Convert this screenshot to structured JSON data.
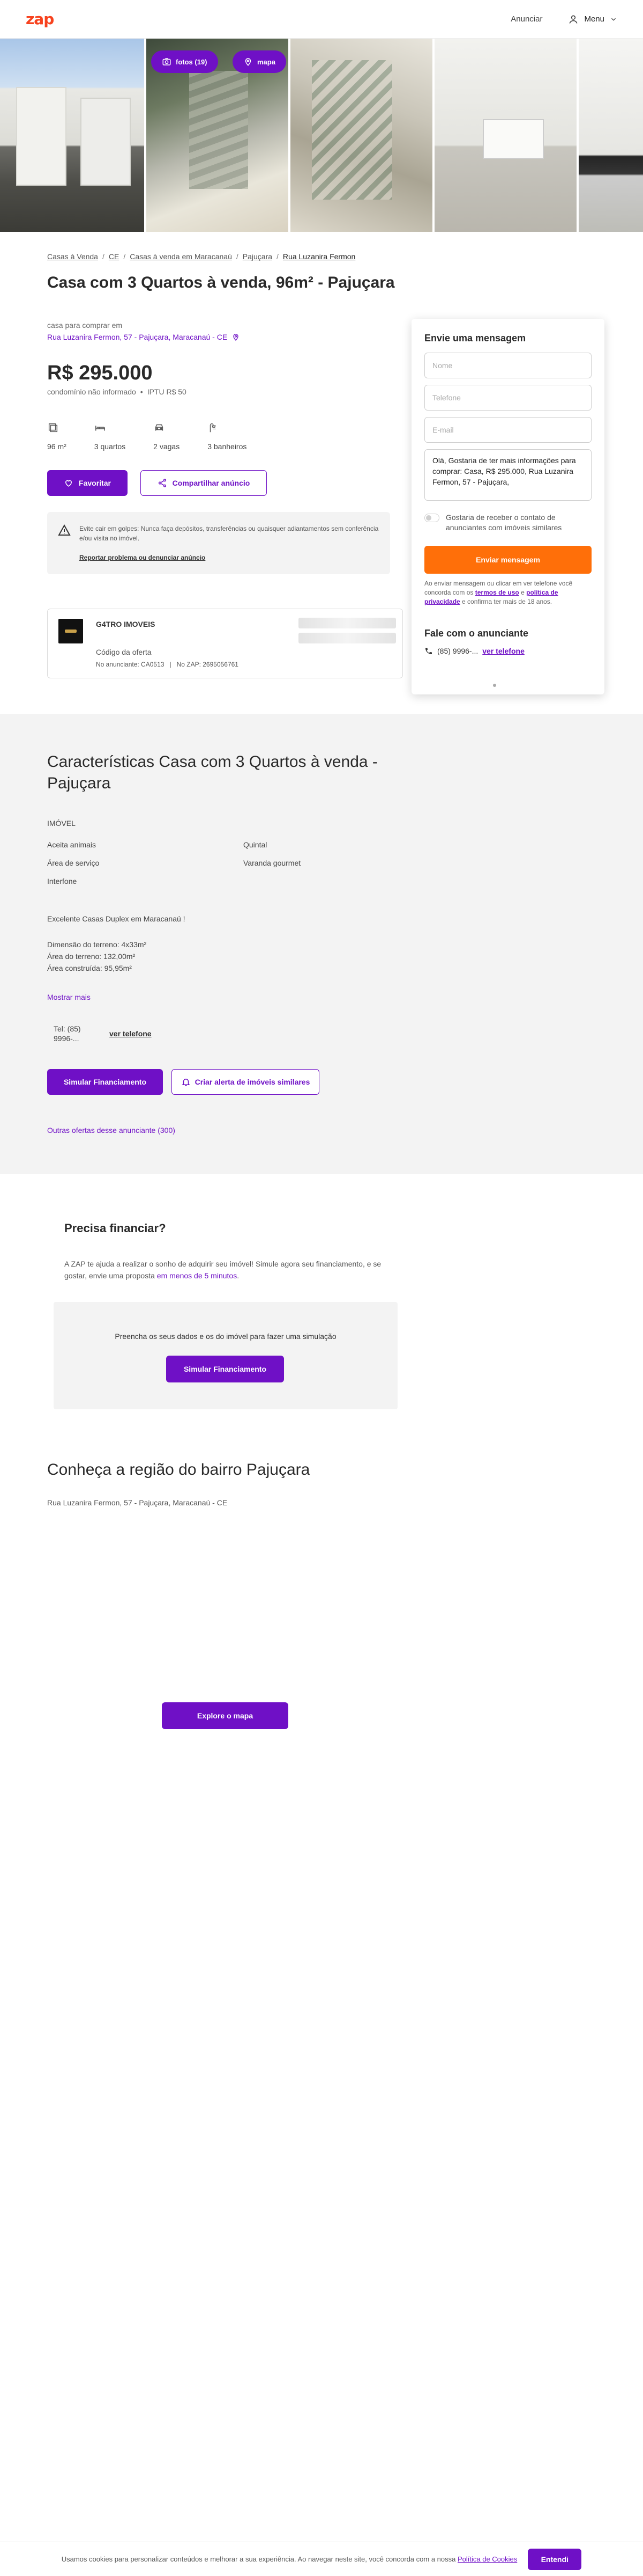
{
  "header": {
    "logo": "zap",
    "announce_label": "Anunciar",
    "menu_label": "Menu"
  },
  "gallery": {
    "photos_button": "fotos (19)",
    "map_button": "mapa"
  },
  "breadcrumb": [
    "Casas à Venda",
    "CE",
    "Casas à venda em Maracanaú",
    "Pajuçara",
    "Rua Luzanira Fermon"
  ],
  "listing": {
    "title": "Casa com 3 Quartos à venda, 96m² - Pajuçara",
    "subtitle": "casa para comprar em",
    "address": "Rua Luzanira Fermon, 57 - Pajuçara, Maracanaú - CE",
    "price": "R$ 295.000",
    "condo": "condomínio não informado",
    "bullet": "•",
    "iptu": "IPTU R$ 50",
    "amenities": [
      {
        "icon": "area-icon",
        "label": "96 m²"
      },
      {
        "icon": "bed-icon",
        "label": "3 quartos"
      },
      {
        "icon": "car-icon",
        "label": "2 vagas"
      },
      {
        "icon": "shower-icon",
        "label": "3 banheiros"
      }
    ],
    "favorite_label": "Favoritar",
    "share_label": "Compartilhar anúncio",
    "warning_text": "Evite cair em golpes: Nunca faça depósitos, transferências ou quaisquer adiantamentos sem conferência e/ou visita no imóvel.",
    "report_label": "Reportar problema ou denunciar anúncio"
  },
  "advertiser": {
    "name": "G4TRO IMOVEIS",
    "code_label": "Código da oferta",
    "advertiser_code": "No anunciante: CA0513",
    "separator": "|",
    "zap_code": "No ZAP: 2695056761"
  },
  "contact": {
    "title": "Envie uma mensagem",
    "name_placeholder": "Nome",
    "phone_placeholder": "Telefone",
    "email_placeholder": "E-mail",
    "message": "Olá, Gostaria de ter mais informações para comprar: Casa, R$ 295.000, Rua Luzanira Fermon, 57 - Pajuçara,",
    "consent": "Gostaria de receber o contato de anunciantes com imóveis similares",
    "send_label": "Enviar mensagem",
    "legal_1": "Ao enviar mensagem ou clicar em ver telefone você concorda com os",
    "terms_label": "termos de uso",
    "legal_2": "e",
    "privacy_label": "política de privacidade",
    "legal_3": "e confirma ter mais de 18 anos.",
    "advertiser_title": "Fale com o anunciante",
    "phone": "(85) 9996-...",
    "see_phone": "ver telefone"
  },
  "characteristics": {
    "title": "Características Casa com 3 Quartos à venda - Pajuçara",
    "category": "IMÓVEL",
    "features_left": [
      "Aceita animais",
      "Área de serviço",
      "Interfone"
    ],
    "features_right": [
      "Quintal",
      "Varanda gourmet"
    ],
    "description": [
      "Excelente Casas Duplex em Maracanaú !",
      "Dimensão do terreno: 4x33m²",
      "Área do terreno: 132,00m²",
      "Área construída: 95,95m²"
    ],
    "more_label": "Mostrar mais",
    "tel_label": "Tel: (85) 9996-...",
    "see_phone": "ver telefone",
    "simulate_label": "Simular Financiamento",
    "alert_label": "Criar alerta de imóveis similares",
    "others_label": "Outras ofertas desse anunciante (300)"
  },
  "financing": {
    "title": "Precisa financiar?",
    "text_1": "A ZAP te ajuda a realizar o sonho de adquirir seu imóvel! Simule agora seu financiamento, e se gostar, envie uma proposta",
    "text_highlight": "em menos de 5 minutos",
    "text_2": ".",
    "box_text": "Preencha os seus dados e os do imóvel para fazer uma simulação",
    "button_label": "Simular Financiamento"
  },
  "region": {
    "title": "Conheça a região do bairro Pajuçara",
    "address": "Rua Luzanira Fermon, 57 - Pajuçara, Maracanaú - CE",
    "map_button": "Explore o mapa"
  },
  "cookie": {
    "text": "Usamos cookies para personalizar conteúdos e melhorar a sua experiência. Ao navegar neste site, você concorda com a nossa",
    "policy_label": "Política de Cookies",
    "ok_label": "Entendi"
  },
  "colors": {
    "brand": "#f7421e",
    "primary": "#6f10c6",
    "cta": "#ff6f09"
  }
}
